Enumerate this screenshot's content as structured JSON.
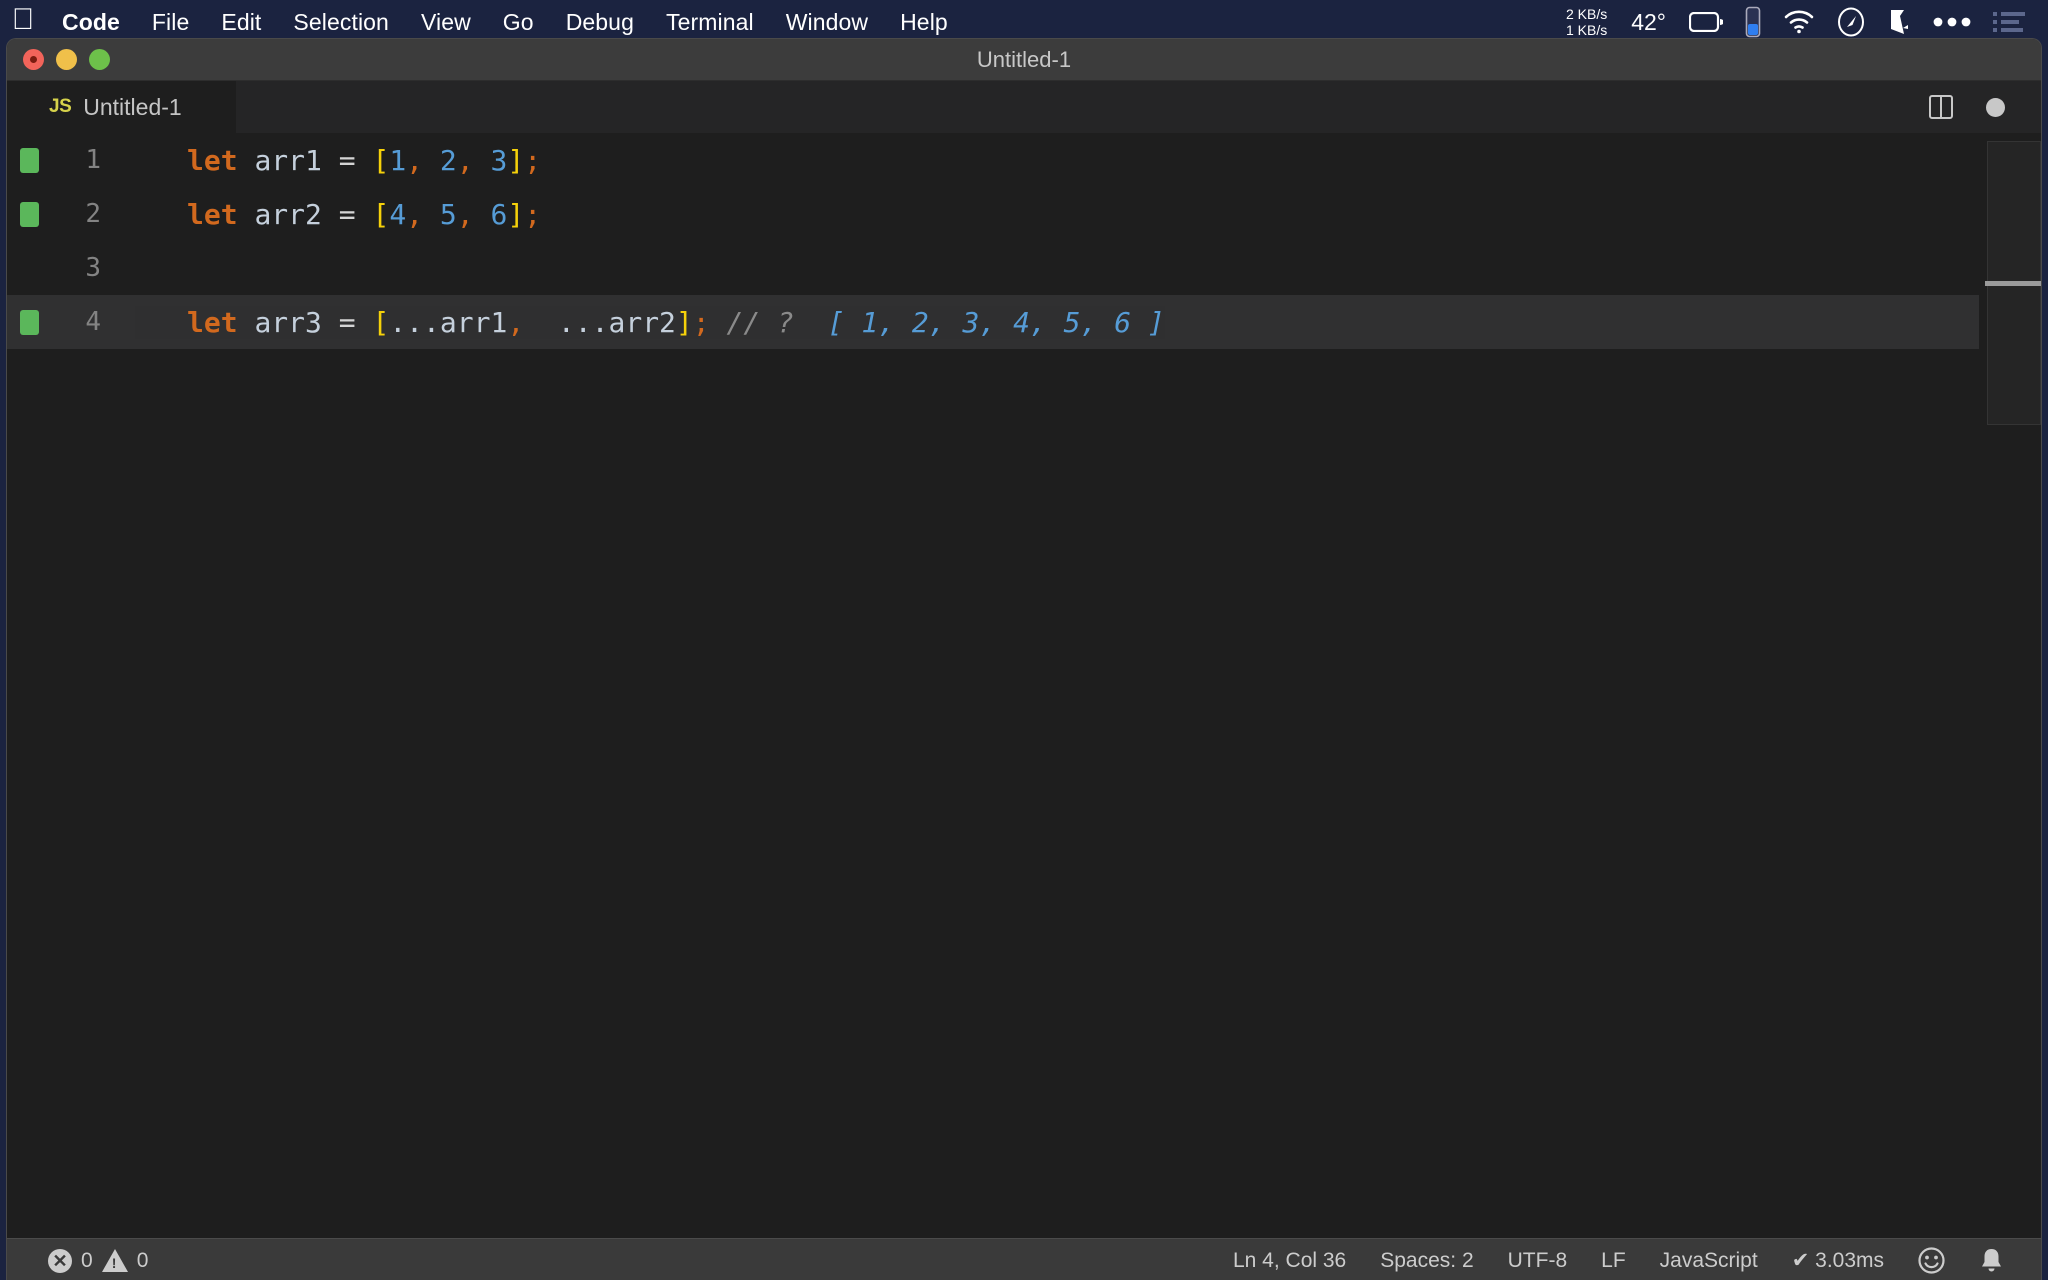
{
  "menubar": {
    "apple_icon": "apple-logo",
    "items": [
      {
        "label": "Code",
        "bold": true
      },
      {
        "label": "File",
        "bold": false
      },
      {
        "label": "Edit",
        "bold": false
      },
      {
        "label": "Selection",
        "bold": false
      },
      {
        "label": "View",
        "bold": false
      },
      {
        "label": "Go",
        "bold": false
      },
      {
        "label": "Debug",
        "bold": false
      },
      {
        "label": "Terminal",
        "bold": false
      },
      {
        "label": "Window",
        "bold": false
      },
      {
        "label": "Help",
        "bold": false
      }
    ],
    "network_down": "2 KB/s",
    "network_up": "1 KB/s",
    "temperature": "42°",
    "tray_icons": [
      "battery-icon",
      "blue-indicator-icon",
      "wifi-icon",
      "speedometer-icon",
      "dropbox-icon",
      "ellipsis-icon",
      "list-icon"
    ],
    "background_color": "#1b2340"
  },
  "window": {
    "title": "Untitled-1",
    "traffic_lights": [
      "close-button",
      "minimize-button",
      "maximize-button"
    ]
  },
  "tabbar": {
    "tabs": [
      {
        "badge": "JS",
        "label": "Untitled-1",
        "badge_color": "#d6d24b"
      }
    ],
    "actions": [
      "split-editor-icon",
      "more-actions-dot-icon"
    ]
  },
  "editor": {
    "lines": [
      {
        "number": "1",
        "git_modified": true,
        "active": false,
        "tokens": [
          {
            "text": "let",
            "cls": "t-kw"
          },
          {
            "text": " ",
            "cls": "t-op"
          },
          {
            "text": "arr1",
            "cls": "t-var"
          },
          {
            "text": " = ",
            "cls": "t-op"
          },
          {
            "text": "[",
            "cls": "t-brk"
          },
          {
            "text": "1",
            "cls": "t-num"
          },
          {
            "text": ", ",
            "cls": "t-punc"
          },
          {
            "text": "2",
            "cls": "t-num"
          },
          {
            "text": ", ",
            "cls": "t-punc"
          },
          {
            "text": "3",
            "cls": "t-num"
          },
          {
            "text": "]",
            "cls": "t-brk"
          },
          {
            "text": ";",
            "cls": "t-punc"
          }
        ]
      },
      {
        "number": "2",
        "git_modified": true,
        "active": false,
        "tokens": [
          {
            "text": "let",
            "cls": "t-kw"
          },
          {
            "text": " ",
            "cls": "t-op"
          },
          {
            "text": "arr2",
            "cls": "t-var"
          },
          {
            "text": " = ",
            "cls": "t-op"
          },
          {
            "text": "[",
            "cls": "t-brk"
          },
          {
            "text": "4",
            "cls": "t-num"
          },
          {
            "text": ", ",
            "cls": "t-punc"
          },
          {
            "text": "5",
            "cls": "t-num"
          },
          {
            "text": ", ",
            "cls": "t-punc"
          },
          {
            "text": "6",
            "cls": "t-num"
          },
          {
            "text": "]",
            "cls": "t-brk"
          },
          {
            "text": ";",
            "cls": "t-punc"
          }
        ]
      },
      {
        "number": "3",
        "git_modified": false,
        "active": false,
        "tokens": []
      },
      {
        "number": "4",
        "git_modified": true,
        "active": true,
        "tokens": [
          {
            "text": "let",
            "cls": "t-kw"
          },
          {
            "text": " ",
            "cls": "t-op"
          },
          {
            "text": "arr3",
            "cls": "t-var"
          },
          {
            "text": " = ",
            "cls": "t-op"
          },
          {
            "text": "[",
            "cls": "t-brk"
          },
          {
            "text": "...arr1",
            "cls": "t-var"
          },
          {
            "text": ", ",
            "cls": "t-punc"
          },
          {
            "text": " ...arr2",
            "cls": "t-var"
          },
          {
            "text": "]",
            "cls": "t-brk"
          },
          {
            "text": ";",
            "cls": "t-punc"
          },
          {
            "text": " ",
            "cls": "t-op"
          },
          {
            "text": "// ?  ",
            "cls": "t-cmt"
          },
          {
            "text": "[ 1, 2, 3, 4, 5, 6 ]",
            "cls": "t-cmt-blue"
          }
        ]
      }
    ],
    "full_text_line_1": "let arr1 = [1, 2, 3];",
    "full_text_line_2": "let arr2 = [4, 5, 6];",
    "full_text_line_3": "",
    "full_text_line_4": "let arr3 = [ ...arr1,  ...arr2]; // ?  [ 1, 2, 3, 4, 5, 6 ]",
    "language": "JavaScript"
  },
  "statusbar": {
    "errors": "0",
    "warnings": "0",
    "cursor": "Ln 4, Col 36",
    "indentation": "Spaces: 2",
    "encoding": "UTF-8",
    "eol": "LF",
    "language": "JavaScript",
    "timing": "✔ 3.03ms",
    "right_icons": [
      "feedback-smiley-icon",
      "notifications-bell-icon"
    ]
  }
}
